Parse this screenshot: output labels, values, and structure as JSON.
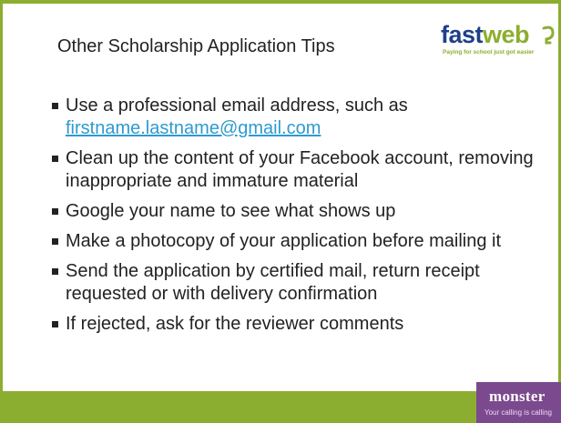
{
  "slide": {
    "title": "Other Scholarship Application Tips"
  },
  "header_logo": {
    "name": "fastweb",
    "name_part1": "fast",
    "name_part2": "web",
    "tagline": "Paying for school just got easier"
  },
  "bullets": [
    {
      "text": "Use a professional email address, such as ",
      "link_text": "firstname.lastname@gmail.com"
    },
    {
      "text": "Clean up the content of your Facebook account, removing inappropriate and immature material"
    },
    {
      "text": "Google your name to see what shows up"
    },
    {
      "text": "Make a photocopy of your application before mailing it"
    },
    {
      "text": "Send the application by certified mail, return receipt requested or with delivery confirmation"
    },
    {
      "text": "If rejected, ask for the reviewer comments"
    }
  ],
  "footer_logo": {
    "name": "monster",
    "tagline": "Your calling is calling"
  },
  "colors": {
    "accent_green": "#8cae30",
    "fastweb_blue": "#1f3f8a",
    "monster_purple": "#7b4a8e",
    "link_blue": "#2e9ad0"
  }
}
